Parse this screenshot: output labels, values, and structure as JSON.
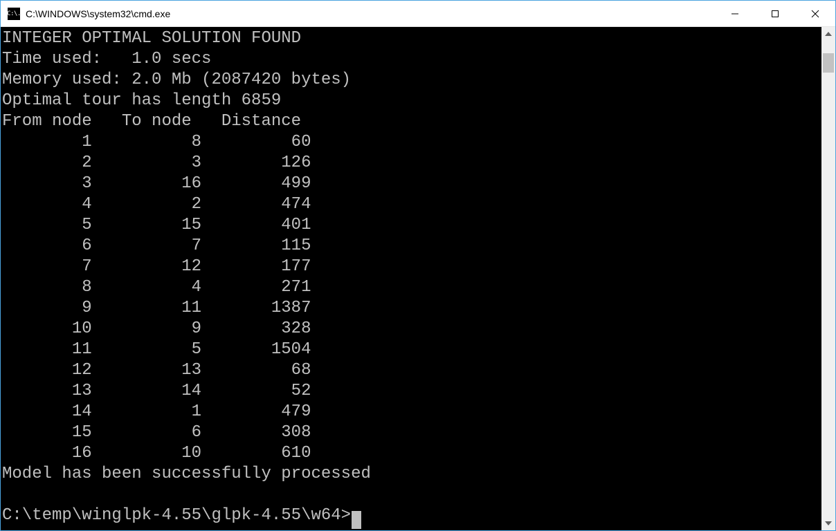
{
  "titlebar": {
    "icon_text": "C:\\.",
    "title": "C:\\WINDOWS\\system32\\cmd.exe"
  },
  "output": {
    "solution_line": "INTEGER OPTIMAL SOLUTION FOUND",
    "time_line": "Time used:   1.0 secs",
    "memory_line": "Memory used: 2.0 Mb (2087420 bytes)",
    "tour_line": "Optimal tour has length 6859",
    "table_header": {
      "from": "From node",
      "to": "To node",
      "dist": "Distance"
    },
    "rows": [
      {
        "from": 1,
        "to": 8,
        "dist": 60
      },
      {
        "from": 2,
        "to": 3,
        "dist": 126
      },
      {
        "from": 3,
        "to": 16,
        "dist": 499
      },
      {
        "from": 4,
        "to": 2,
        "dist": 474
      },
      {
        "from": 5,
        "to": 15,
        "dist": 401
      },
      {
        "from": 6,
        "to": 7,
        "dist": 115
      },
      {
        "from": 7,
        "to": 12,
        "dist": 177
      },
      {
        "from": 8,
        "to": 4,
        "dist": 271
      },
      {
        "from": 9,
        "to": 11,
        "dist": 1387
      },
      {
        "from": 10,
        "to": 9,
        "dist": 328
      },
      {
        "from": 11,
        "to": 5,
        "dist": 1504
      },
      {
        "from": 12,
        "to": 13,
        "dist": 68
      },
      {
        "from": 13,
        "to": 14,
        "dist": 52
      },
      {
        "from": 14,
        "to": 1,
        "dist": 479
      },
      {
        "from": 15,
        "to": 6,
        "dist": 308
      },
      {
        "from": 16,
        "to": 10,
        "dist": 610
      }
    ],
    "processed_line": "Model has been successfully processed",
    "prompt": "C:\\temp\\winglpk-4.55\\glpk-4.55\\w64>"
  }
}
